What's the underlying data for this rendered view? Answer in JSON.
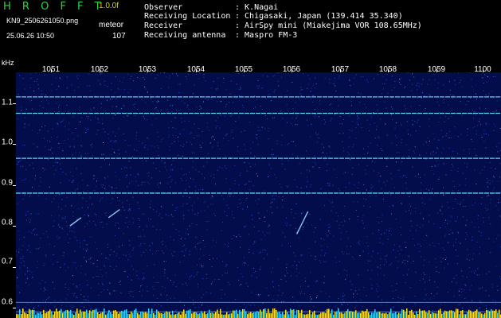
{
  "header": {
    "app_title": "H R O F F T",
    "version": "1.0.0f",
    "file_name": "KN9_2506261050.png",
    "meteor_label": "meteor",
    "timestamp": "25.06.26 10:50",
    "meteor_count": "107"
  },
  "station_info": [
    {
      "key": "Observer",
      "value": ": K.Nagai"
    },
    {
      "key": "Receiving Location",
      "value": ": Chigasaki, Japan (139.414 35.340)"
    },
    {
      "key": "Receiver",
      "value": ": AirSpy mini (Miakejima VOR 108.65MHz)"
    },
    {
      "key": "Receiving antenna",
      "value": ": Maspro FM-3"
    }
  ],
  "axes": {
    "y_unit": "kHz",
    "y_ticks": [
      "1.1",
      "1.0",
      "0.9",
      "0.8",
      "0.7",
      "0.6"
    ],
    "y_tick_values": [
      1.1,
      1.0,
      0.9,
      0.8,
      0.7,
      0.6
    ],
    "y_range": [
      0.575,
      1.175
    ],
    "x_ticks": [
      "1051",
      "1052",
      "1053",
      "1054",
      "1055",
      "1056",
      "1057",
      "1058",
      "1059",
      "1100"
    ],
    "x_range_minutes": [
      1050.45,
      1060.5
    ]
  },
  "colors": {
    "background": "#030d4c",
    "title": "#2fd23a",
    "version": "#d9d000",
    "carrier_lines": "#66e6ff",
    "baseline_bars": "#ffe020"
  },
  "spectrogram": {
    "carrier_lines_khz": [
      1.115,
      1.075,
      0.965,
      0.88
    ],
    "meteor_echoes": [
      {
        "minute": 1051.8,
        "khz_start": 0.82,
        "khz_end": 0.8
      },
      {
        "minute": 1052.6,
        "khz_start": 0.84,
        "khz_end": 0.82
      },
      {
        "minute": 1056.5,
        "khz_start": 0.835,
        "khz_end": 0.78
      }
    ]
  }
}
